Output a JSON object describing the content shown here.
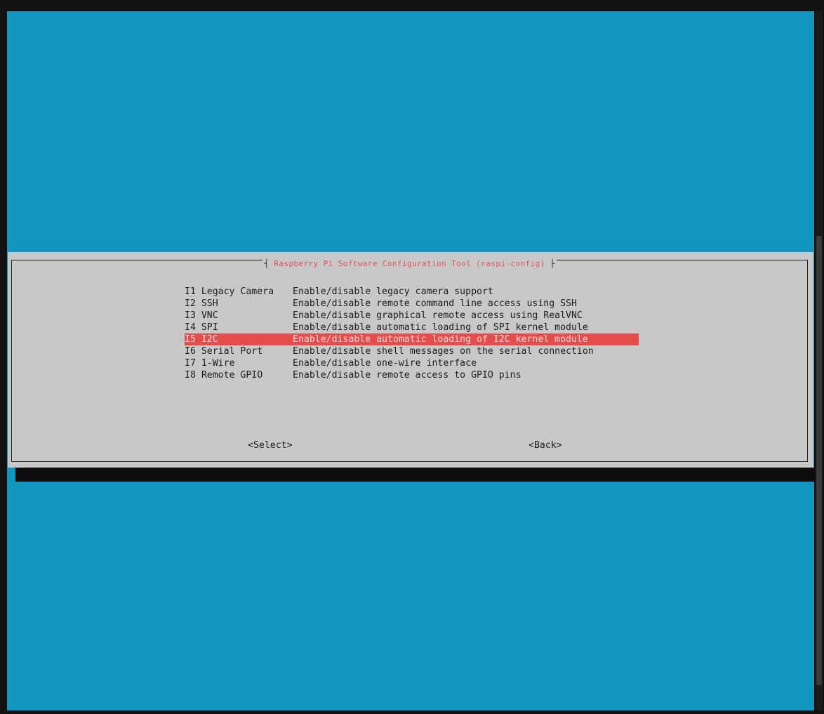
{
  "dialog": {
    "title": "Raspberry Pi Software Configuration Tool (raspi-config)"
  },
  "menu": {
    "items": [
      {
        "tag": "I1 Legacy Camera",
        "desc": "Enable/disable legacy camera support"
      },
      {
        "tag": "I2 SSH",
        "desc": "Enable/disable remote command line access using SSH"
      },
      {
        "tag": "I3 VNC",
        "desc": "Enable/disable graphical remote access using RealVNC"
      },
      {
        "tag": "I4 SPI",
        "desc": "Enable/disable automatic loading of SPI kernel module"
      },
      {
        "tag": "I5 I2C",
        "desc": "Enable/disable automatic loading of I2C kernel module"
      },
      {
        "tag": "I6 Serial Port",
        "desc": "Enable/disable shell messages on the serial connection"
      },
      {
        "tag": "I7 1-Wire",
        "desc": "Enable/disable one-wire interface"
      },
      {
        "tag": "I8 Remote GPIO",
        "desc": "Enable/disable remote access to GPIO pins"
      }
    ],
    "selected_index": 4
  },
  "buttons": {
    "select_label": "<Select>",
    "back_label": "<Back>"
  },
  "colors": {
    "background": "#1296c0",
    "dialog": "#c8c8c8",
    "highlight": "#e54d4d",
    "title_text": "#e55050"
  }
}
